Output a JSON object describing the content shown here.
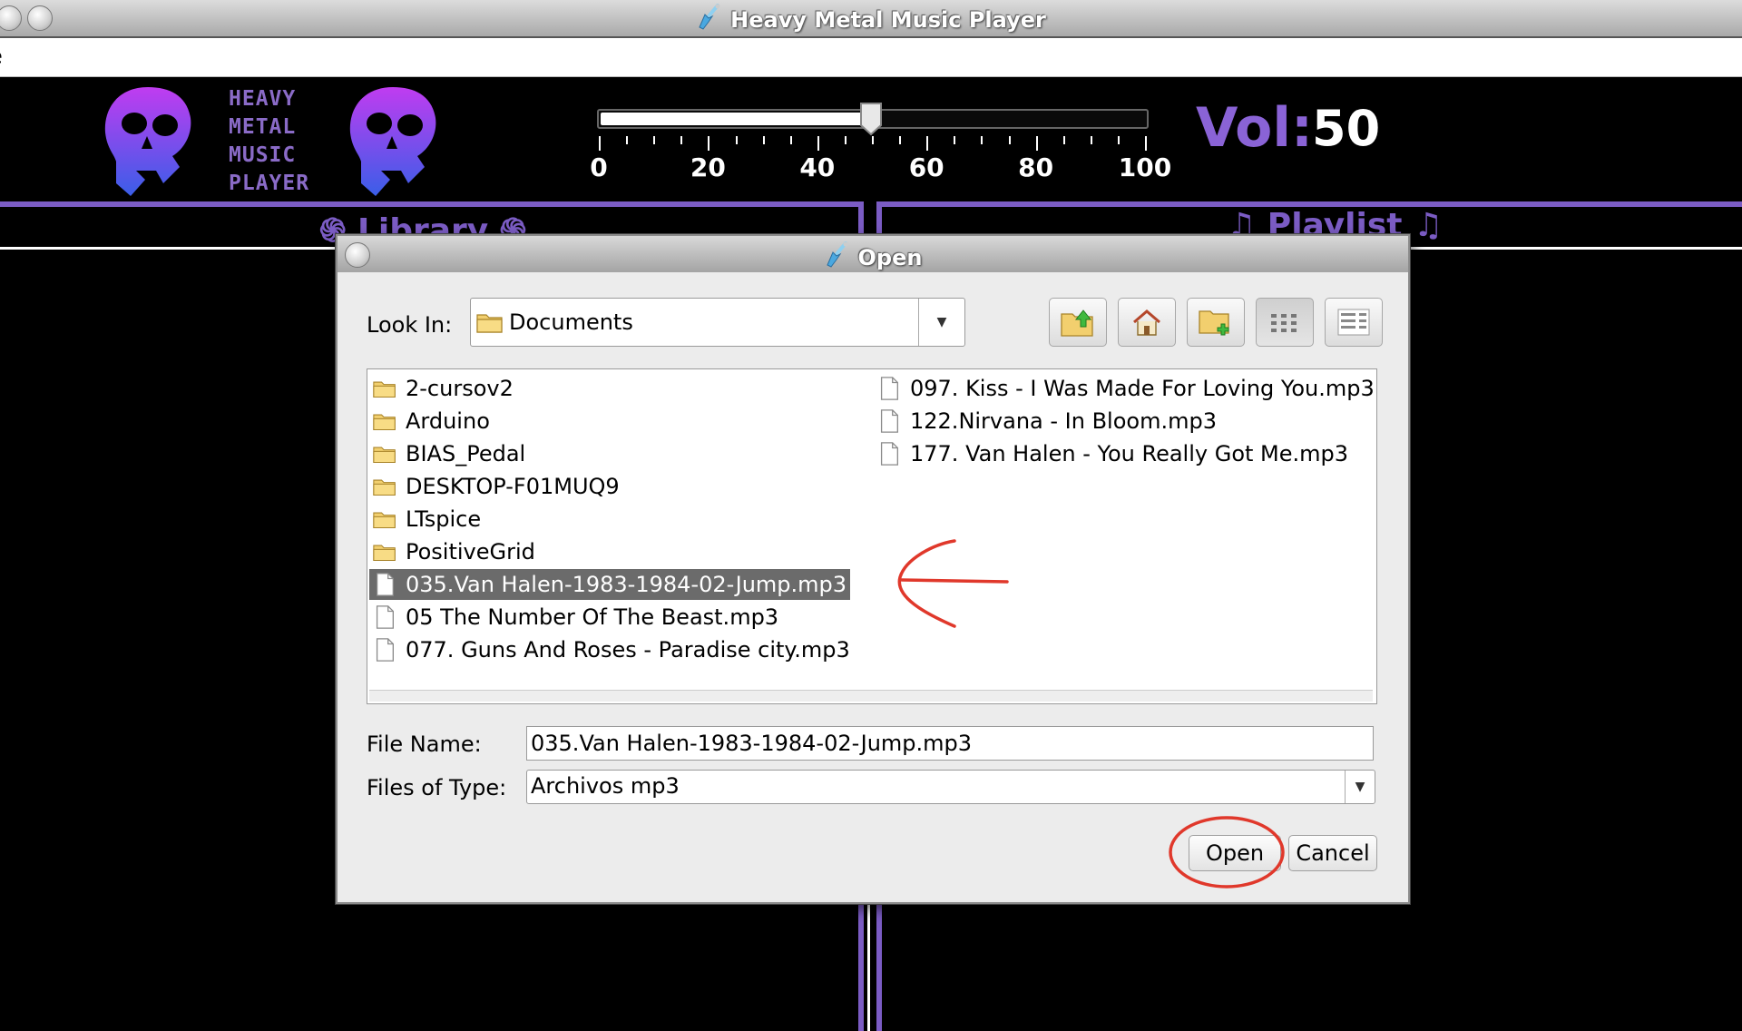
{
  "window": {
    "title": "Heavy Metal Music Player",
    "menu_file_partial": "e"
  },
  "logo": {
    "lines": [
      "HEAVY",
      "METAL",
      "MUSIC",
      "PLAYER"
    ]
  },
  "volume": {
    "label": "Vol:",
    "value": "50",
    "level_percent": 50,
    "tick_labels": [
      "0",
      "20",
      "40",
      "60",
      "80",
      "100"
    ]
  },
  "panels": {
    "library_title": "֍ Library ֍",
    "playlist_title": "♫ Playlist ♫"
  },
  "dialog": {
    "title": "Open",
    "look_in_label": "Look In:",
    "look_in_value": "Documents",
    "toolbar": [
      "up-folder-icon",
      "home-icon",
      "new-folder-icon",
      "list-view-icon",
      "details-view-icon"
    ],
    "files_col1": [
      {
        "name": "2-cursov2",
        "type": "folder"
      },
      {
        "name": "Arduino",
        "type": "folder"
      },
      {
        "name": "BIAS_Pedal",
        "type": "folder"
      },
      {
        "name": "DESKTOP-F01MUQ9",
        "type": "folder"
      },
      {
        "name": "LTspice",
        "type": "folder"
      },
      {
        "name": "PositiveGrid",
        "type": "folder"
      },
      {
        "name": "035.Van Halen-1983-1984-02-Jump.mp3",
        "type": "file",
        "selected": true
      },
      {
        "name": "05 The Number Of The Beast.mp3",
        "type": "file"
      },
      {
        "name": "077. Guns And Roses - Paradise city.mp3",
        "type": "file"
      }
    ],
    "files_col2": [
      {
        "name": "097. Kiss - I Was Made For Loving You.mp3",
        "type": "file"
      },
      {
        "name": "122.Nirvana - In Bloom.mp3",
        "type": "file"
      },
      {
        "name": "177. Van Halen - You Really Got Me.mp3",
        "type": "file"
      }
    ],
    "file_name_label": "File Name:",
    "file_name_value": "035.Van Halen-1983-1984-02-Jump.mp3",
    "file_type_label": "Files of Type:",
    "file_type_value": "Archivos mp3",
    "open_button": "Open",
    "cancel_button": "Cancel"
  },
  "colors": {
    "accent_purple": "#7b5cc4",
    "annotation_red": "#e0382b",
    "selection": "#6b6b6b"
  }
}
